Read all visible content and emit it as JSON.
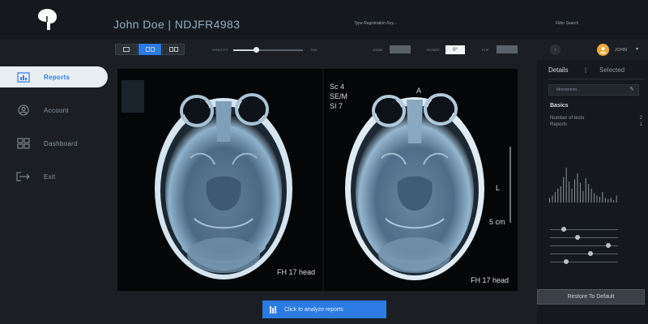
{
  "header": {
    "patient_name": "John Doe | NDJFR4983",
    "search_registration_placeholder": "Type Registration Key...",
    "search_filter_placeholder": "Filter Search"
  },
  "toolbar": {
    "views": [
      "single-view",
      "split-view",
      "compare-view"
    ],
    "active_view": "split-view",
    "opacity_label": "OPACITY",
    "opacity_value_text": "70%",
    "opacity_level": 0.33,
    "zoom_label": "ZOOM",
    "zoom_value": "",
    "rotate_label": "ROTATE",
    "rotate_value": "0°",
    "flip_label": "FLIP",
    "flip_value": ""
  },
  "user": {
    "name": "JOHN",
    "avatar_icon": "user-avatar-icon",
    "caret": "▾",
    "prev_arrow": "›"
  },
  "sidebar": {
    "items": [
      {
        "label": "Reports",
        "icon": "reports-icon",
        "active": true
      },
      {
        "label": "Account",
        "icon": "account-icon",
        "active": false
      },
      {
        "label": "Dashboard",
        "icon": "dashboard-icon",
        "active": false
      },
      {
        "label": "Exit",
        "icon": "exit-icon",
        "active": false
      }
    ]
  },
  "viewer": {
    "left_overlay": {
      "top_left": [
        "Sc 4",
        "SE/M",
        "SI 7"
      ],
      "bottom_right": "FH 17 head"
    },
    "right_overlay": {
      "top_left": [
        "Sc 4",
        "SE/M",
        "SI 7"
      ],
      "orientation_marker": "A",
      "side_marker": "L",
      "scale_label": "5 cm",
      "bottom_right": "FH 17 head"
    }
  },
  "actions": {
    "analyze_label": "Click to analyze reports",
    "restore_label": "Restore To Default"
  },
  "details_panel": {
    "tab_details": "Details",
    "tab_separator": "|",
    "tab_selected": "Selected",
    "input_value": "Mmmmmm",
    "basics_title": "Basics",
    "stats": [
      {
        "label": "Number of tests",
        "value": "2"
      },
      {
        "label": "Reports",
        "value": "1"
      }
    ],
    "histogram_values": [
      4,
      6,
      9,
      12,
      14,
      22,
      30,
      18,
      12,
      20,
      25,
      17,
      10,
      21,
      16,
      12,
      8,
      6,
      5,
      9,
      4,
      3,
      4,
      2,
      6
    ],
    "slider_levels": [
      0.2,
      0.4,
      0.86,
      0.6,
      0.24
    ]
  },
  "colors": {
    "accent": "#2c7be5",
    "avatar": "#f0a93a",
    "background": "#1b1f24"
  }
}
